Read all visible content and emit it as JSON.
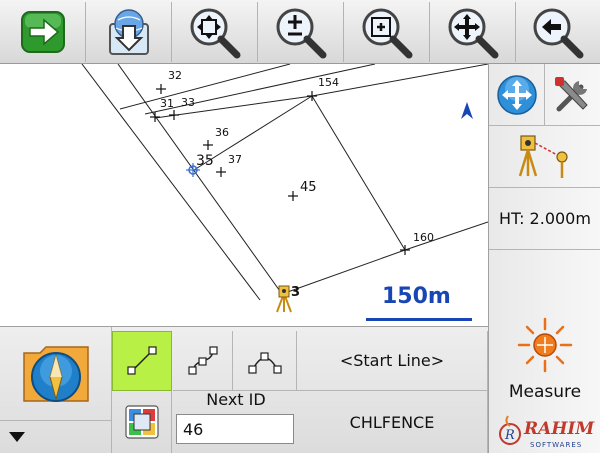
{
  "toolbar": {
    "buttons": [
      {
        "name": "forward-arrow-icon"
      },
      {
        "name": "download-map-icon"
      },
      {
        "name": "zoom-extent-icon"
      },
      {
        "name": "zoom-in-out-icon"
      },
      {
        "name": "zoom-window-icon"
      },
      {
        "name": "pan-icon"
      },
      {
        "name": "zoom-previous-icon"
      }
    ]
  },
  "map": {
    "points": [
      {
        "id": "32",
        "label": "32"
      },
      {
        "id": "31",
        "label": "31"
      },
      {
        "id": "33",
        "label": "33"
      },
      {
        "id": "154",
        "label": "154"
      },
      {
        "id": "36",
        "label": "36"
      },
      {
        "id": "35",
        "label": "35"
      },
      {
        "id": "37",
        "label": "37"
      },
      {
        "id": "45",
        "label": "45"
      },
      {
        "id": "160",
        "label": "160"
      },
      {
        "id": "3",
        "label": "3"
      }
    ],
    "scale_label": "150m",
    "north_arrow_color": "#1846b4"
  },
  "right_panel": {
    "ht_label": "HT: 2.000m",
    "measure_label": "Measure"
  },
  "bottom": {
    "start_line_label": "<Start Line>",
    "next_id_label": "Next ID",
    "next_id_value": "46",
    "code_label": "CHLFENCE"
  },
  "colors": {
    "accent_green": "#b8f046",
    "scale_blue": "#1846b4"
  },
  "watermark": {
    "brand": "RAHIM",
    "sub": "SOFTWARES"
  }
}
